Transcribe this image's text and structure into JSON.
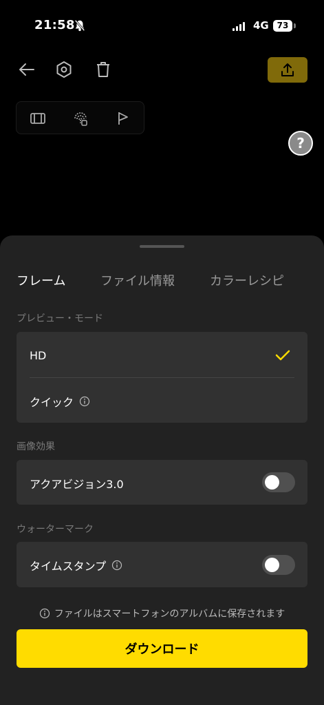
{
  "status_bar": {
    "time": "21:58",
    "network": "4G",
    "battery": "73"
  },
  "icons": {
    "back": "back-arrow-icon",
    "settings": "hexagon-settings-icon",
    "delete": "trash-icon",
    "upload": "upload-icon",
    "film": "film-icon",
    "fingerprint": "fingerprint-icon",
    "flag": "flag-icon",
    "help": "?"
  },
  "tabs": [
    {
      "label": "フレーム",
      "active": true
    },
    {
      "label": "ファイル情報",
      "active": false
    },
    {
      "label": "カラーレシピ",
      "active": false
    }
  ],
  "preview_mode": {
    "label": "プレビュー・モード",
    "options": [
      {
        "label": "HD",
        "selected": true
      },
      {
        "label": "クイック",
        "selected": false
      }
    ]
  },
  "image_effect": {
    "label": "画像効果",
    "option": {
      "label": "アクアビジョン3.0",
      "enabled": false
    }
  },
  "watermark": {
    "label": "ウォーターマーク",
    "option": {
      "label": "タイムスタンプ",
      "enabled": false
    }
  },
  "note": "ファイルはスマートフォンのアルバムに保存されます",
  "download_label": "ダウンロード",
  "colors": {
    "accent": "#ffdc00",
    "sheet": "#222222",
    "card": "#313131"
  }
}
